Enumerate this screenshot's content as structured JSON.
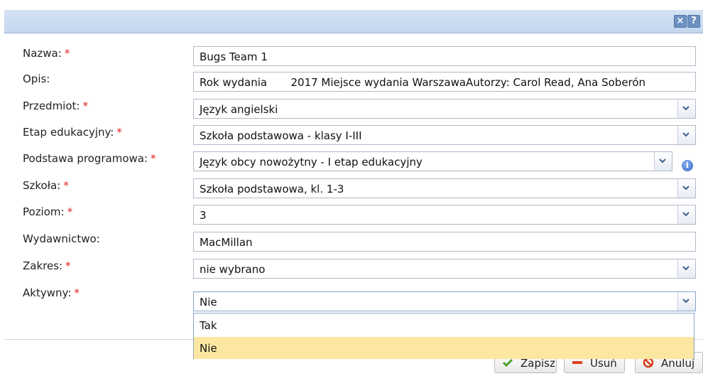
{
  "titlebar": {
    "close_label": "×",
    "help_label": "?"
  },
  "form": {
    "nazwa": {
      "label": "Nazwa:",
      "value": "Bugs Team 1"
    },
    "opis": {
      "label": "Opis:",
      "value": "Rok wydania       2017 Miejsce wydania WarszawaAutorzy: Carol Read, Ana Soberón"
    },
    "przedmiot": {
      "label": "Przedmiot:",
      "value": "Język angielski"
    },
    "etap": {
      "label": "Etap edukacyjny:",
      "value": "Szkoła podstawowa - klasy I-III"
    },
    "podstawa": {
      "label": "Podstawa programowa:",
      "value": "Język obcy nowożytny - I etap edukacyjny"
    },
    "szkola": {
      "label": "Szkoła:",
      "value": "Szkoła podstawowa, kl. 1-3"
    },
    "poziom": {
      "label": "Poziom:",
      "value": "3"
    },
    "wydawnictwo": {
      "label": "Wydawnictwo:",
      "value": "MacMillan"
    },
    "zakres": {
      "label": "Zakres:",
      "value": "nie wybrano"
    },
    "aktywny": {
      "label": "Aktywny:",
      "value": "Nie"
    },
    "required_mark": "*",
    "info_icon": "i"
  },
  "dropdown": {
    "options": [
      "Tak",
      "Nie"
    ],
    "selected": "Nie"
  },
  "footer": {
    "save_label": "Zapisz",
    "delete_label": "Usuń",
    "cancel_label": "Anuluj"
  },
  "colors": {
    "titlebar": "#c9daf0",
    "required": "#e02020",
    "selected_option": "#fce7a2",
    "info": "#2c63c6"
  }
}
